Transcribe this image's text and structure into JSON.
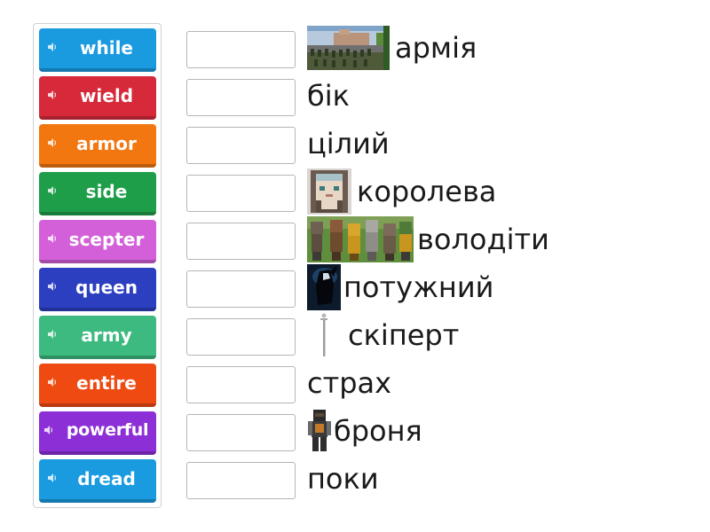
{
  "tiles": [
    {
      "label": "while",
      "color": "#1a9be0"
    },
    {
      "label": "wield",
      "color": "#d62a3a"
    },
    {
      "label": "armor",
      "color": "#f27710"
    },
    {
      "label": "side",
      "color": "#1f9e4a"
    },
    {
      "label": "scepter",
      "color": "#d360d8"
    },
    {
      "label": "queen",
      "color": "#2b3fc0"
    },
    {
      "label": "army",
      "color": "#3dba7f"
    },
    {
      "label": "entire",
      "color": "#ef4a12"
    },
    {
      "label": "powerful",
      "color": "#8c2fd6"
    },
    {
      "label": "dread",
      "color": "#1a9be0"
    }
  ],
  "clues": [
    {
      "text": "армія",
      "image": "minecraft-army-image"
    },
    {
      "text": "бік",
      "image": null
    },
    {
      "text": "цілий",
      "image": null
    },
    {
      "text": "королева",
      "image": "minecraft-queen-image"
    },
    {
      "text": "володіти",
      "image": "minecraft-group-image"
    },
    {
      "text": "потужний",
      "image": "dark-figure-image"
    },
    {
      "text": "скіперт",
      "image": "scepter-image"
    },
    {
      "text": "страх",
      "image": null
    },
    {
      "text": "броня",
      "image": "minecraft-armor-image"
    },
    {
      "text": "поки",
      "image": null
    }
  ]
}
